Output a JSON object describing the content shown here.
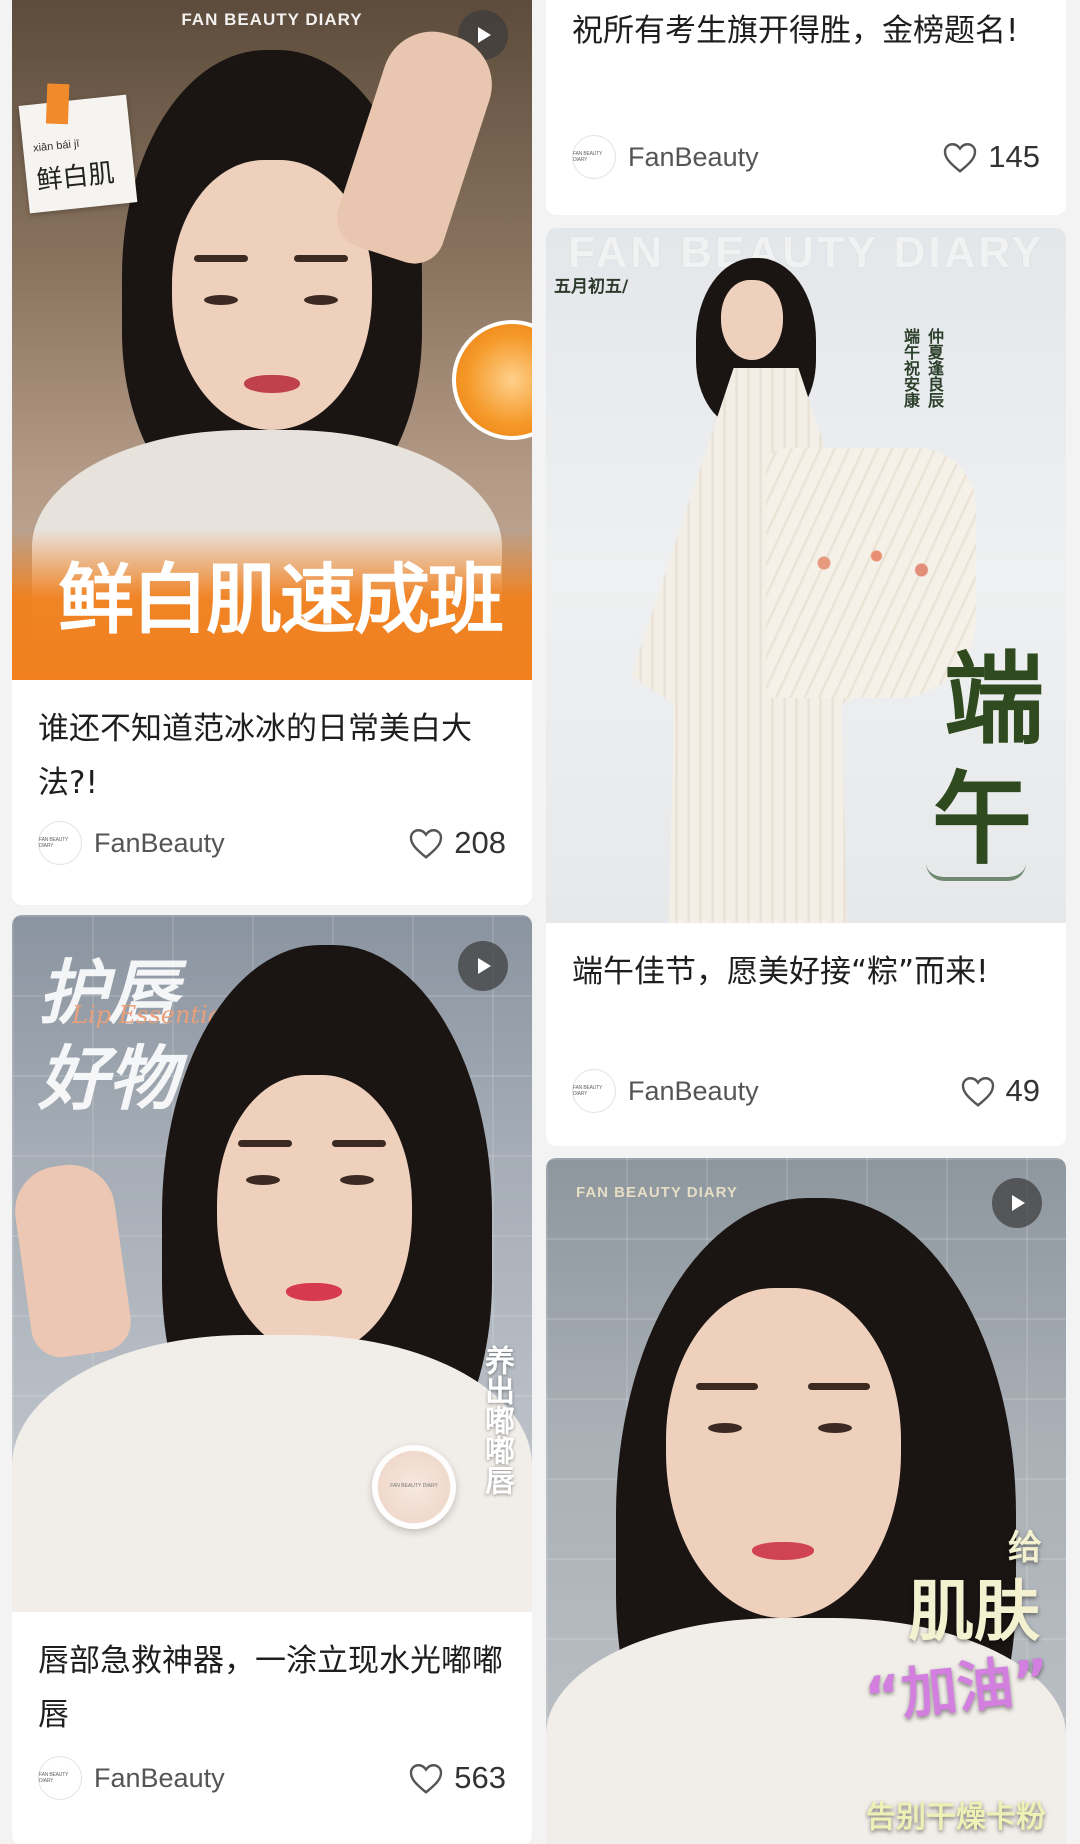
{
  "brand_watermark": "FAN BEAUTY DIARY",
  "brand_colors": {
    "orange": "#f07f1c",
    "like_gray": "#555555",
    "card_bg": "#ffffff",
    "page_bg": "#f3f3f3"
  },
  "cards": [
    {
      "cover_label_pinyin": "xiān  bái  jī",
      "cover_label": "鲜白肌",
      "cover_headline": "鲜白肌速成班",
      "title": "谁还不知道范冰冰的日常美白大法?!",
      "author": "FanBeauty",
      "likes": "208",
      "avatar_text": "FAN BEAUTY DIARY",
      "play_icon": "play-icon",
      "like_icon": "heart-outline-icon"
    },
    {
      "cover_headline_line1": "护唇",
      "cover_headline_line2": "好物",
      "cover_script": "Lip Essentials",
      "cover_vertical": "养出嘟嘟唇",
      "product_label": "FAN BEAUTY DIARY",
      "title": "唇部急救神器，一涂立现水光嘟嘟唇",
      "author": "FanBeauty",
      "likes": "563",
      "avatar_text": "FAN BEAUTY DIARY"
    },
    {
      "title": "祝所有考生旗开得胜，金榜题名!",
      "author": "FanBeauty",
      "likes": "145",
      "avatar_text": "FAN BEAUTY DIARY"
    },
    {
      "cover_date": "五月初五/",
      "cover_poem_right": "仲夏逢良辰",
      "cover_poem_left": "端午祝安康",
      "cover_headline_top": "端",
      "cover_headline_bottom": "午",
      "title": "端午佳节，愿美好接“粽”而来!",
      "author": "FanBeauty",
      "likes": "49",
      "avatar_text": "FAN BEAUTY DIARY"
    },
    {
      "cover_headline_line1": "肌肤",
      "cover_headline_give": "给",
      "cover_headline_line2": "“加油”",
      "cover_footer": "告别干燥卡粉"
    }
  ]
}
